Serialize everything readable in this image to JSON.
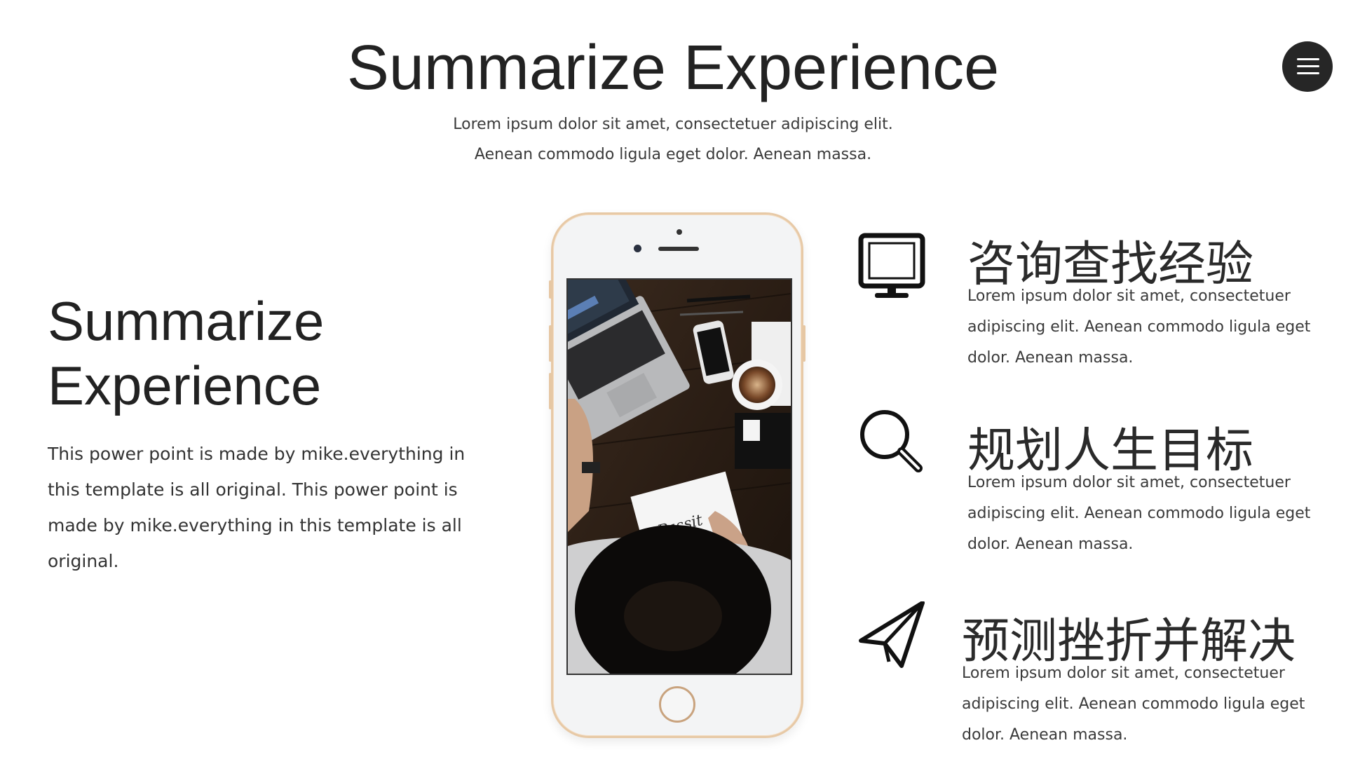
{
  "header": {
    "title": "Summarize Experience",
    "subtitle": "Lorem ipsum dolor sit amet, consectetuer adipiscing elit. Aenean commodo ligula eget dolor. Aenean massa."
  },
  "menu": {
    "icon": "hamburger-menu-icon"
  },
  "left": {
    "title_line1": "Summarize",
    "title_line2": "Experience",
    "body": "This power point is made by mike.everything in this template is all original. This power point is made by mike.everything in this template is all original."
  },
  "phone": {
    "screen_image": "desk-workspace-photo",
    "notebook_text": "Passit"
  },
  "features": [
    {
      "icon": "monitor-icon",
      "title": "咨询查找经验",
      "text": "Lorem ipsum dolor sit amet, consectetuer adipiscing elit. Aenean commodo ligula eget dolor. Aenean massa."
    },
    {
      "icon": "magnifier-icon",
      "title": "规划人生目标",
      "text": "Lorem ipsum dolor sit amet, consectetuer adipiscing elit. Aenean commodo ligula eget dolor. Aenean massa."
    },
    {
      "icon": "paper-plane-icon",
      "title": "预测挫折并解决",
      "text": "Lorem ipsum dolor sit amet, consectetuer adipiscing elit. Aenean commodo ligula eget dolor. Aenean massa."
    }
  ],
  "colors": {
    "text": "#262626",
    "menu_bg": "#262626",
    "phone_frame": "#e7c9a6"
  }
}
